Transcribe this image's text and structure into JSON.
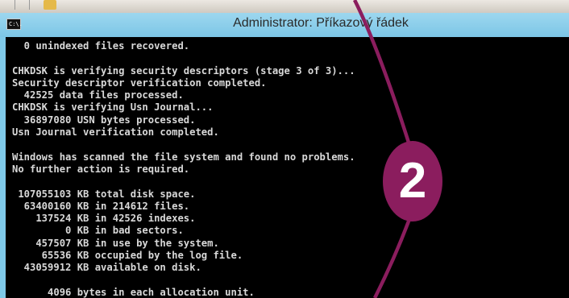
{
  "window": {
    "title": "Administrator: Příkazový řádek",
    "icon": "cmd-icon",
    "icon_text": "C:\\."
  },
  "console": {
    "lines": [
      "  0 unindexed files recovered.",
      "",
      "CHKDSK is verifying security descriptors (stage 3 of 3)...",
      "Security descriptor verification completed.",
      "  42525 data files processed.",
      "CHKDSK is verifying Usn Journal...",
      "  36897080 USN bytes processed.",
      "Usn Journal verification completed.",
      "",
      "Windows has scanned the file system and found no problems.",
      "No further action is required.",
      "",
      " 107055103 KB total disk space.",
      "  63400160 KB in 214612 files.",
      "    137524 KB in 42526 indexes.",
      "         0 KB in bad sectors.",
      "    457507 KB in use by the system.",
      "     65536 KB occupied by the log file.",
      "  43059912 KB available on disk.",
      "",
      "      4096 bytes in each allocation unit."
    ]
  },
  "annotation": {
    "badge_number": "2",
    "color": "#8b1d5e"
  }
}
